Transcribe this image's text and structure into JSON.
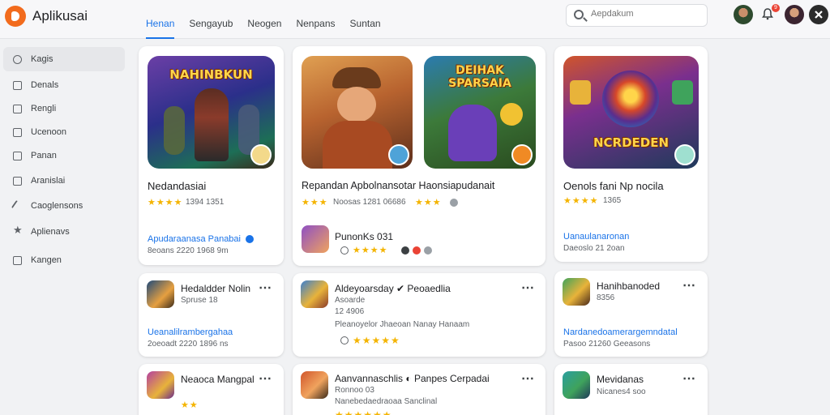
{
  "app": {
    "title": "Aplikusai"
  },
  "tabs": [
    {
      "label": "Henan",
      "active": true
    },
    {
      "label": "Sengayub"
    },
    {
      "label": "Neogen"
    },
    {
      "label": "Nenpans"
    },
    {
      "label": "Suntan"
    }
  ],
  "search": {
    "placeholder": "Aepdakum"
  },
  "notifications": {
    "count": "9"
  },
  "sidebar": {
    "items": [
      {
        "label": "Kagis",
        "icon": "grid-icon",
        "active": true
      },
      {
        "label": "Denals",
        "icon": "person-icon"
      },
      {
        "label": "Rengli",
        "icon": "library-icon"
      },
      {
        "label": "Ucenoon",
        "icon": "chat-icon"
      },
      {
        "label": "Panan",
        "icon": "folder-icon"
      },
      {
        "label": "Aranislai",
        "icon": "book-icon"
      },
      {
        "label": "Caoglensons",
        "icon": "rocket-icon"
      },
      {
        "label": "Aplienavs",
        "icon": "star-icon"
      },
      {
        "label": "Kangen",
        "icon": "window-icon"
      }
    ]
  },
  "featured": [
    {
      "art_text": "NAHINBKUN",
      "title": "Nedandasiai",
      "rating": "★★★★",
      "meta": "1394 1351",
      "link": "Apudaraanasa Panabai",
      "sub": "8eoans 2220 1968 9m"
    },
    {
      "art_text_1": "",
      "art_text_2": "DEIHAK SPARSAIA",
      "title": "Repandan Apbolnansotar Haonsiapudanait",
      "rating_1": "★★★",
      "meta": "Noosas 1281 06686",
      "rating_2": "★★★",
      "dev_name": "PunonKs 031",
      "dev_stars": "★★★★"
    },
    {
      "art_text": "NCRDEDEN",
      "title": "Oenols fani Np nocila",
      "rating": "★★★★",
      "meta": "1365",
      "link": "Uanaulanaronan",
      "sub": "Daeoslo 21 2oan"
    }
  ],
  "rows": [
    [
      {
        "title": "Hedaldder Nolin",
        "meta": "Spruse 18",
        "link": "Ueanalilrambergahaa",
        "sub": "2oeoadt 2220 1896 ns"
      },
      {
        "title": "Aldeyoarsday ✔ Peoaedlia",
        "line1": "Asoarde",
        "line2": "12 4906",
        "line3": "Pleanoyelor Jhaeoan Nanay Hanaam",
        "stars": "★★★★★"
      },
      {
        "title": "Hanihbanoded",
        "meta": "8356",
        "link": "Nardanedoamerargemndatal",
        "sub": "Pasoo 21260 Geeasons"
      }
    ],
    [
      {
        "title": "Neaoca Mangpal",
        "stars": "★★"
      },
      {
        "title": "Aanvannaschlis ◐ Panpes Cerpadai",
        "line1": "Ronnoo 03",
        "line2": "Nanebedaedraoaa Sanclinal",
        "stars": "★★★★★★"
      },
      {
        "title": "Mevidanas",
        "meta": "Nicanes4 soo"
      }
    ]
  ],
  "colors": {
    "accent": "#1a73e8",
    "brand": "#f26b1d",
    "star": "#f4b400"
  }
}
